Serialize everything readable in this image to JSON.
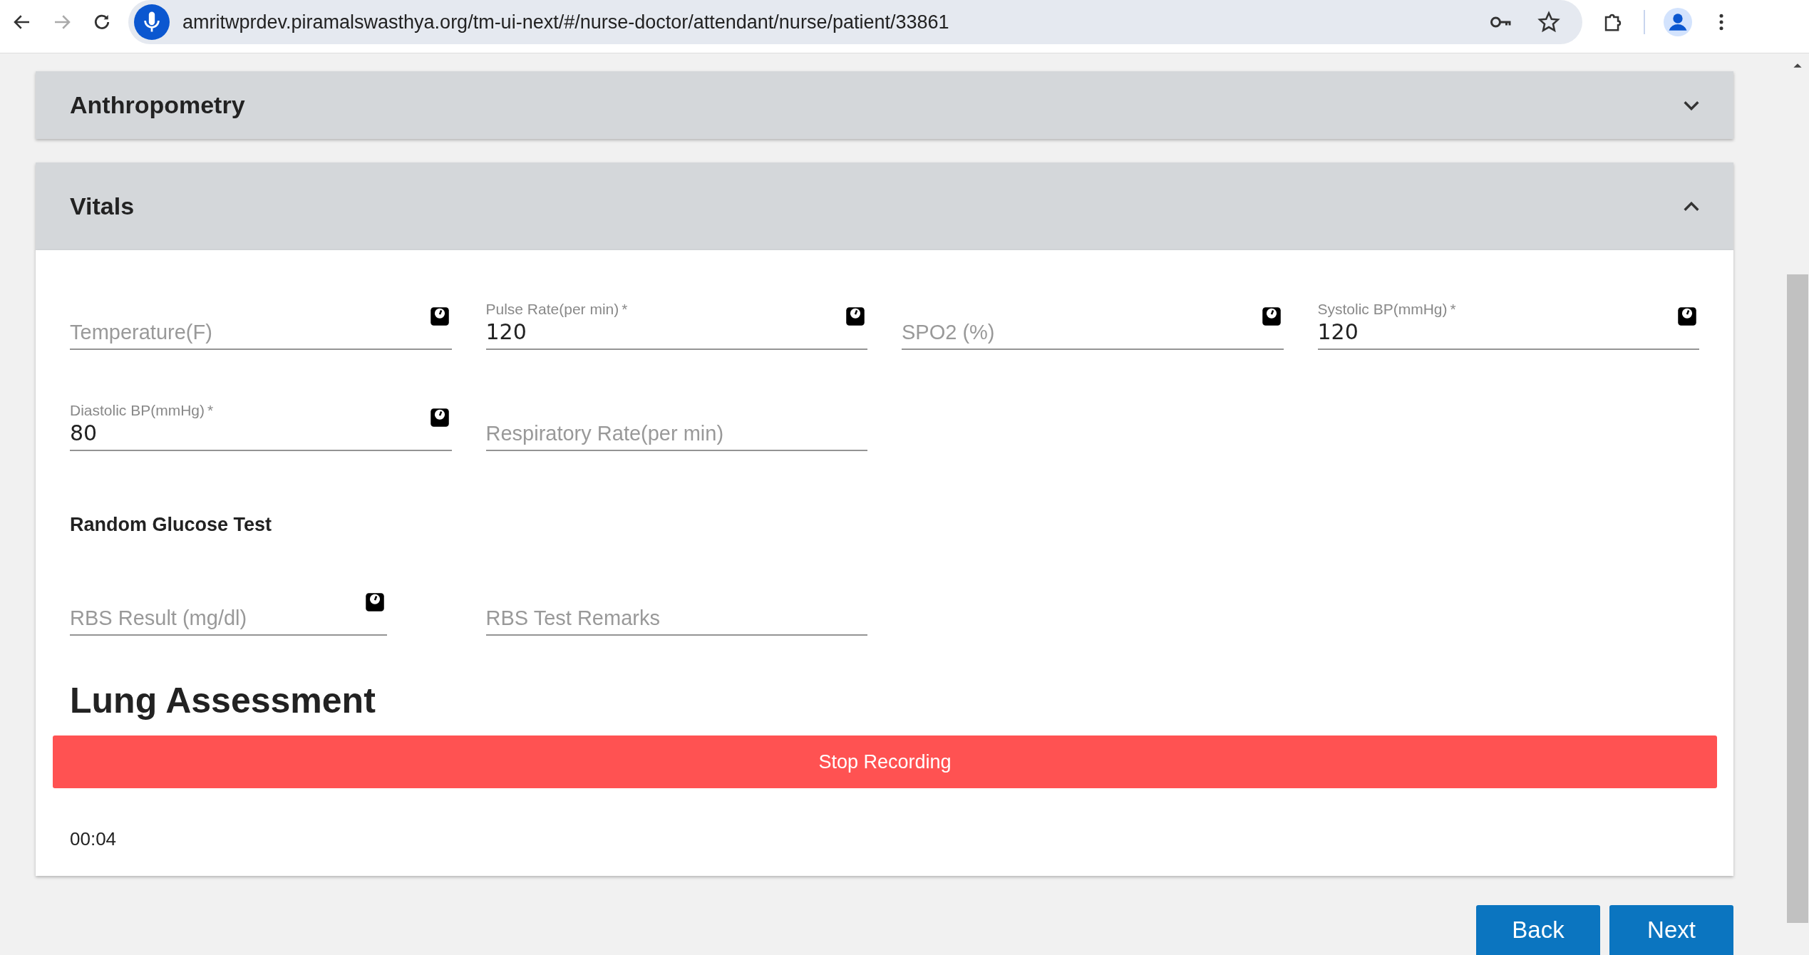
{
  "browser": {
    "url": "amritwprdev.piramalswasthya.org/tm-ui-next/#/nurse-doctor/attendant/nurse/patient/33861"
  },
  "sections": [
    {
      "title": "Anthropometry",
      "expanded": false
    },
    {
      "title": "Vitals",
      "expanded": true
    }
  ],
  "vitals_fields": [
    {
      "placeholder": "Temperature(F)",
      "device_icon": true
    },
    {
      "label": "Pulse Rate(per min)",
      "value": "120",
      "marker": "*",
      "device_icon": true
    },
    {
      "placeholder": "SPO2 (%)",
      "device_icon": true
    },
    {
      "label": "Systolic BP(mmHg)",
      "value": "120",
      "marker": "*",
      "device_icon": true
    },
    {
      "label": "Diastolic BP(mmHg)",
      "value": "80",
      "marker": "*",
      "device_icon": true
    },
    {
      "placeholder": "Respiratory Rate(per min)",
      "device_icon": false
    }
  ],
  "glucose": {
    "title": "Random Glucose Test",
    "fields": [
      {
        "placeholder": "RBS Result (mg/dl)",
        "device_icon": true
      },
      {
        "placeholder": "RBS Test Remarks",
        "device_icon": false
      }
    ]
  },
  "lung": {
    "title": "Lung Assessment",
    "button": "Stop Recording",
    "timer": "00:04"
  },
  "buttons": [
    "Back",
    "Next"
  ]
}
